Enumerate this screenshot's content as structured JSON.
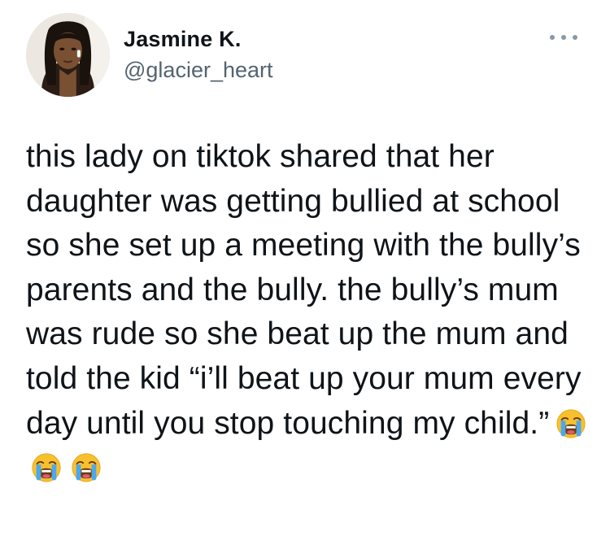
{
  "author": {
    "name": "Jasmine K.",
    "handle": "@glacier_heart"
  },
  "tweet": {
    "text": "this lady on tiktok shared that her daughter was getting bullied at school so she set up a meeting with the bully’s parents and the bully. the bully’s mum was rude so she beat up the mum and told the kid “i’ll beat up your mum every day until you stop touching my child.”",
    "emojis": [
      "loudly-crying-face",
      "loudly-crying-face",
      "loudly-crying-face"
    ]
  },
  "icons": {
    "more": "more-options-icon",
    "avatar": "profile-avatar"
  }
}
